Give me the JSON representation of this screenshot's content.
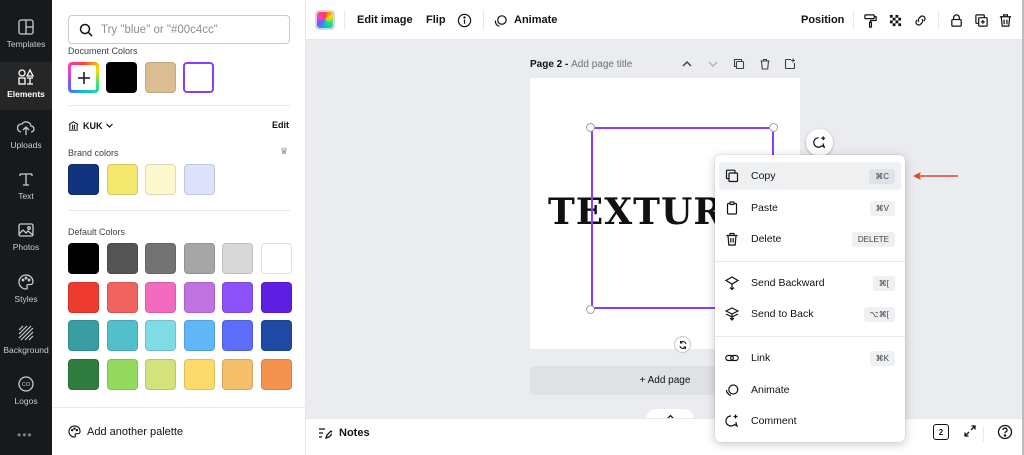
{
  "sidebar": {
    "items": [
      {
        "label": "Templates",
        "icon": "templates-icon"
      },
      {
        "label": "Elements",
        "icon": "elements-icon"
      },
      {
        "label": "Uploads",
        "icon": "uploads-icon"
      },
      {
        "label": "Text",
        "icon": "text-icon"
      },
      {
        "label": "Photos",
        "icon": "photos-icon"
      },
      {
        "label": "Styles",
        "icon": "styles-icon"
      },
      {
        "label": "Background",
        "icon": "background-icon"
      },
      {
        "label": "Logos",
        "icon": "logos-icon"
      }
    ],
    "more": "•••"
  },
  "panel": {
    "search_placeholder": "Try \"blue\" or \"#00c4cc\"",
    "document_colors_title": "Document Colors",
    "document_colors": [
      "#000000",
      "#dcbd92",
      "#ffffff"
    ],
    "brand_kit_name": "KUK",
    "brand_edit": "Edit",
    "brand_colors_title": "Brand colors",
    "brand_colors": [
      "#12347f",
      "#f4e76e",
      "#fdf7cd",
      "#dee3fb"
    ],
    "default_colors_title": "Default Colors",
    "default_colors": [
      "#000000",
      "#545454",
      "#737373",
      "#a6a6a6",
      "#d9d9d9",
      "#ffffff",
      "#ee3a2f",
      "#f06360",
      "#f26bbf",
      "#c072e1",
      "#8d52f7",
      "#5e1fe3",
      "#3a9da3",
      "#53bfcc",
      "#7edce6",
      "#60b6f6",
      "#5c6ef9",
      "#1f4aa3",
      "#2f7d3f",
      "#96d960",
      "#d3e27a",
      "#fcdb6a",
      "#f6bf6c",
      "#f4924f"
    ],
    "add_palette": "Add another palette"
  },
  "toolbar": {
    "edit_image": "Edit image",
    "flip": "Flip",
    "animate": "Animate",
    "position": "Position"
  },
  "canvas": {
    "page_label": "Page 2",
    "page_separator": " - ",
    "page_title_placeholder": "Add page title",
    "element_text": "TEXTURE",
    "add_page": "+ Add page"
  },
  "bottom": {
    "notes": "Notes",
    "page_count": "2"
  },
  "context_menu": {
    "items": [
      {
        "label": "Copy",
        "shortcut": "⌘C",
        "icon": "copy-icon"
      },
      {
        "label": "Paste",
        "shortcut": "⌘V",
        "icon": "paste-icon"
      },
      {
        "label": "Delete",
        "shortcut": "DELETE",
        "icon": "trash-icon"
      },
      {
        "label": "Send Backward",
        "shortcut": "⌘[",
        "icon": "send-backward-icon"
      },
      {
        "label": "Send to Back",
        "shortcut": "⌥⌘[",
        "icon": "send-to-back-icon"
      },
      {
        "label": "Link",
        "shortcut": "⌘K",
        "icon": "link-icon"
      },
      {
        "label": "Animate",
        "shortcut": "",
        "icon": "animate-icon"
      },
      {
        "label": "Comment",
        "shortcut": "",
        "icon": "comment-icon"
      }
    ]
  },
  "colors": {
    "accent": "#8b3dff",
    "annotation_arrow": "#e3402e"
  }
}
